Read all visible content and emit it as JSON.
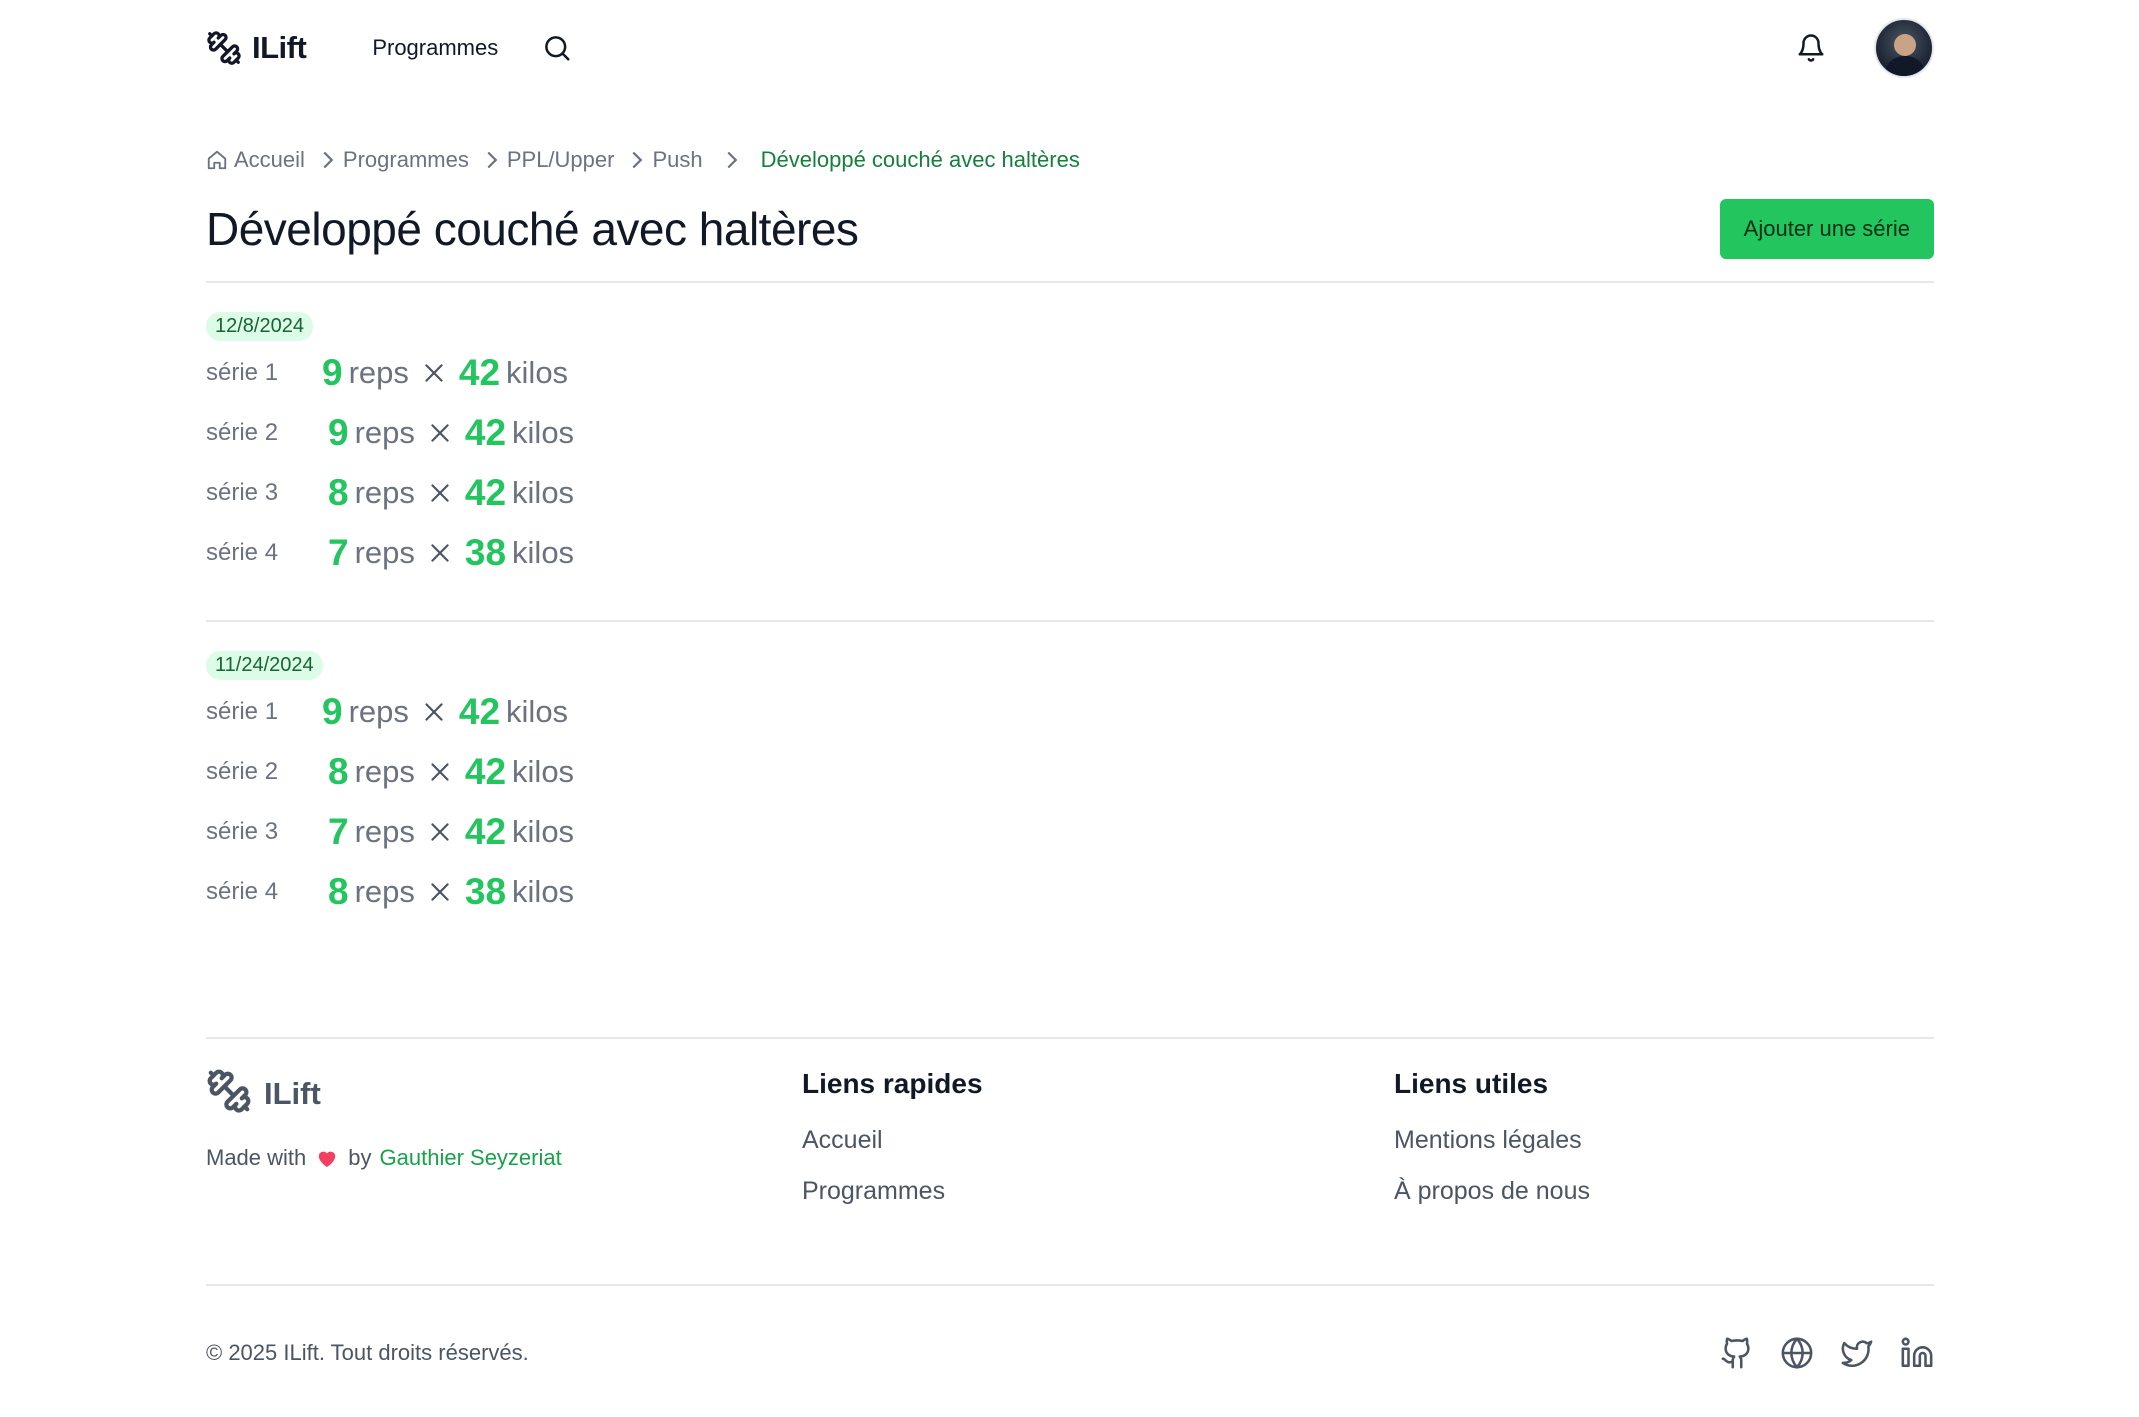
{
  "header": {
    "app_name": "ILift",
    "nav_programmes": "Programmes"
  },
  "breadcrumb": {
    "items": [
      "Accueil",
      "Programmes",
      "PPL/Upper",
      "Push"
    ],
    "current": "Développé couché avec haltères"
  },
  "page": {
    "title": "Développé couché avec haltères",
    "add_button": "Ajouter une série"
  },
  "units": {
    "reps": "reps",
    "kilos": "kilos"
  },
  "sessions": [
    {
      "date": "12/8/2024",
      "sets": [
        {
          "label": "série 1",
          "reps": "9",
          "weight": "42"
        },
        {
          "label": "série 2",
          "reps": "9",
          "weight": "42"
        },
        {
          "label": "série 3",
          "reps": "8",
          "weight": "42"
        },
        {
          "label": "série 4",
          "reps": "7",
          "weight": "38"
        }
      ]
    },
    {
      "date": "11/24/2024",
      "sets": [
        {
          "label": "série 1",
          "reps": "9",
          "weight": "42"
        },
        {
          "label": "série 2",
          "reps": "8",
          "weight": "42"
        },
        {
          "label": "série 3",
          "reps": "7",
          "weight": "42"
        },
        {
          "label": "série 4",
          "reps": "8",
          "weight": "38"
        }
      ]
    }
  ],
  "footer": {
    "brand": "ILift",
    "made_with_prefix": "Made with",
    "made_with_by": "by",
    "author": "Gauthier Seyzeriat",
    "quick_links_title": "Liens rapides",
    "quick_links": [
      "Accueil",
      "Programmes"
    ],
    "useful_links_title": "Liens utiles",
    "useful_links": [
      "Mentions légales",
      "À propos de nous"
    ],
    "copyright": "© 2025 ILift. Tout droits réservés.",
    "social_icons": [
      "github-icon",
      "globe-icon",
      "twitter-icon",
      "linkedin-icon"
    ]
  },
  "colors": {
    "accent": "#22c55e",
    "accent_dark": "#15803d",
    "badge_bg": "#dcfce7",
    "heart": "#f43f5e"
  }
}
